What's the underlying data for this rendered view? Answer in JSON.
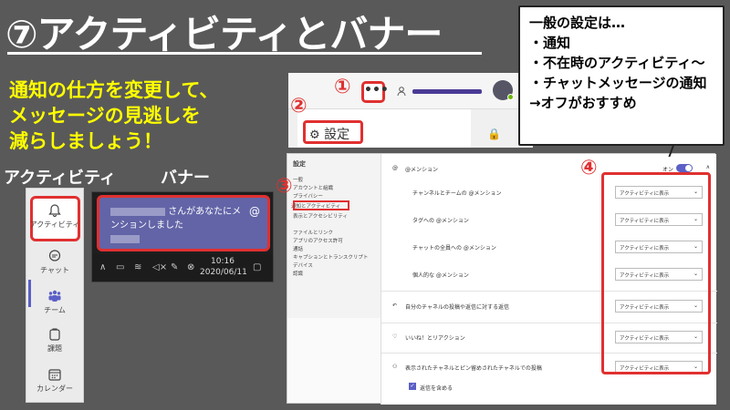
{
  "title": "⑦アクティビティとバナー",
  "subtitle": [
    "通知の仕方を変更して、",
    "メッセージの見逃しを",
    "減らしましょう！"
  ],
  "labels": {
    "activity": "アクティビティ",
    "banner": "バナー"
  },
  "steps": {
    "one": "①",
    "two": "②",
    "three": "③",
    "four": "④"
  },
  "rail": {
    "items": [
      {
        "label": "アクティビティ",
        "icon": "bell-icon"
      },
      {
        "label": "チャット",
        "icon": "chat-icon"
      },
      {
        "label": "チーム",
        "icon": "teams-icon"
      },
      {
        "label": "課題",
        "icon": "assignments-icon"
      },
      {
        "label": "カレンダー",
        "icon": "calendar-icon"
      }
    ]
  },
  "banner": {
    "text_line1": "さんがあなたにメ",
    "text_line2": "ンションしました",
    "at_symbol": "@",
    "time": "10:16",
    "date": "2020/06/11"
  },
  "header": {
    "more_button": "•••",
    "settings_label": "設定"
  },
  "settings": {
    "title": "設定",
    "nav": [
      "一般",
      "アカウントと組織",
      "プライバシー",
      "通知とアクティビティ",
      "表示とアクセシビリティ",
      "ファイルとリンク",
      "アプリのアクセス許可",
      "通話",
      "キャプションとトランスクリプト",
      "デバイス",
      "認識"
    ],
    "mention_header": "@メンション",
    "toggle_label": "オン",
    "rows": [
      {
        "label": "チャンネルとチームの @メンション",
        "value": "アクティビティに表示"
      },
      {
        "label": "タグへの @メンション",
        "value": "アクティビティに表示"
      },
      {
        "label": "チャットの全員への @メンション",
        "value": "アクティビティに表示"
      },
      {
        "label": "個人的な @メンション",
        "value": "アクティビティに表示"
      },
      {
        "label": "自分のチャネルの投稿や返信に対する返信",
        "value": "アクティビティに表示"
      },
      {
        "label": "いいね！とリアクション",
        "value": "アクティビティに表示"
      },
      {
        "label": "表示されたチャネルとピン留めされたチャネルでの投稿",
        "value": "アクティビティに表示"
      }
    ],
    "include_replies": "返信を含める"
  },
  "callout": {
    "lines": [
      "一般の設定は…",
      "・通知",
      "・不在時のアクティビティ～",
      "・チャットメッセージの通知",
      "→オフがおすすめ"
    ]
  },
  "colors": {
    "background": "#595959",
    "accent_red": "#e03030",
    "highlight_yellow": "#ffff00",
    "teams_purple": "#6264a7"
  }
}
